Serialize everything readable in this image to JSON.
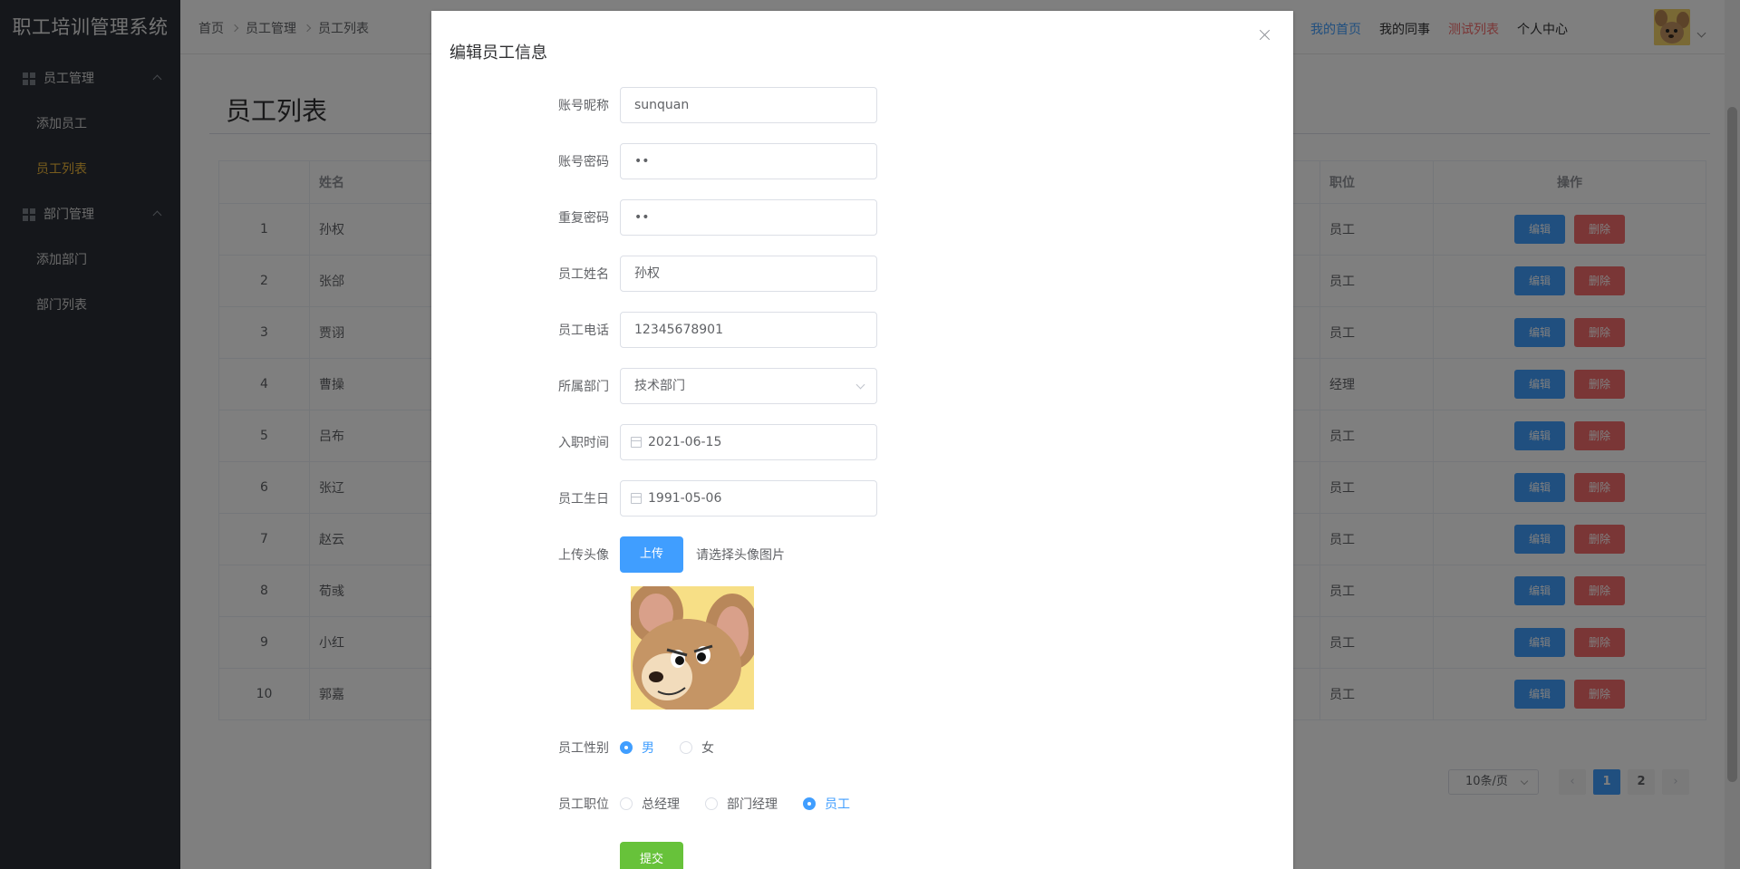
{
  "app": {
    "title": "职工培训管理系统"
  },
  "sidebar": {
    "groups": [
      {
        "label": "员工管理",
        "items": [
          {
            "label": "添加员工"
          },
          {
            "label": "员工列表"
          }
        ]
      },
      {
        "label": "部门管理",
        "items": [
          {
            "label": "添加部门"
          },
          {
            "label": "部门列表"
          }
        ]
      }
    ]
  },
  "breadcrumb": [
    "首页",
    "员工管理",
    "员工列表"
  ],
  "topnav": {
    "home": "我的首页",
    "colleagues": "我的同事",
    "test": "测试列表",
    "profile": "个人中心"
  },
  "page": {
    "title": "员工列表"
  },
  "table": {
    "headers": {
      "name": "姓名",
      "position": "职位",
      "actions": "操作"
    },
    "edit_label": "编辑",
    "delete_label": "删除",
    "rows": [
      {
        "index": "1",
        "name": "孙权",
        "position": "员工"
      },
      {
        "index": "2",
        "name": "张郃",
        "position": "员工"
      },
      {
        "index": "3",
        "name": "贾诩",
        "position": "员工"
      },
      {
        "index": "4",
        "name": "曹操",
        "position": "经理"
      },
      {
        "index": "5",
        "name": "吕布",
        "position": "员工"
      },
      {
        "index": "6",
        "name": "张辽",
        "position": "员工"
      },
      {
        "index": "7",
        "name": "赵云",
        "position": "员工"
      },
      {
        "index": "8",
        "name": "荀彧",
        "position": "员工"
      },
      {
        "index": "9",
        "name": "小红",
        "position": "员工"
      },
      {
        "index": "10",
        "name": "郭嘉",
        "position": "员工"
      }
    ]
  },
  "pagination": {
    "page_size": "10条/页",
    "pages": [
      "1",
      "2"
    ],
    "current": "1"
  },
  "dialog": {
    "title": "编辑员工信息",
    "fields": {
      "account_label": "账号昵称",
      "account_value": "sunquan",
      "password_label": "账号密码",
      "password_value": "••",
      "repeat_label": "重复密码",
      "repeat_value": "••",
      "name_label": "员工姓名",
      "name_value": "孙权",
      "phone_label": "员工电话",
      "phone_value": "12345678901",
      "dept_label": "所属部门",
      "dept_value": "技术部门",
      "hire_label": "入职时间",
      "hire_value": "2021-06-15",
      "birth_label": "员工生日",
      "birth_value": "1991-05-06",
      "avatar_label": "上传头像",
      "upload_button": "上传",
      "upload_tip": "请选择头像图片",
      "gender_label": "员工性别",
      "gender_male": "男",
      "gender_female": "女",
      "position_label": "员工职位",
      "pos_gm": "总经理",
      "pos_dm": "部门经理",
      "pos_staff": "员工"
    },
    "submit_label": "提交"
  },
  "colors": {
    "primary": "#409eff",
    "danger": "#f56c6c",
    "success": "#67c23a",
    "sidebar_bg": "#2b2f36",
    "active_menu": "#f0b93b"
  }
}
